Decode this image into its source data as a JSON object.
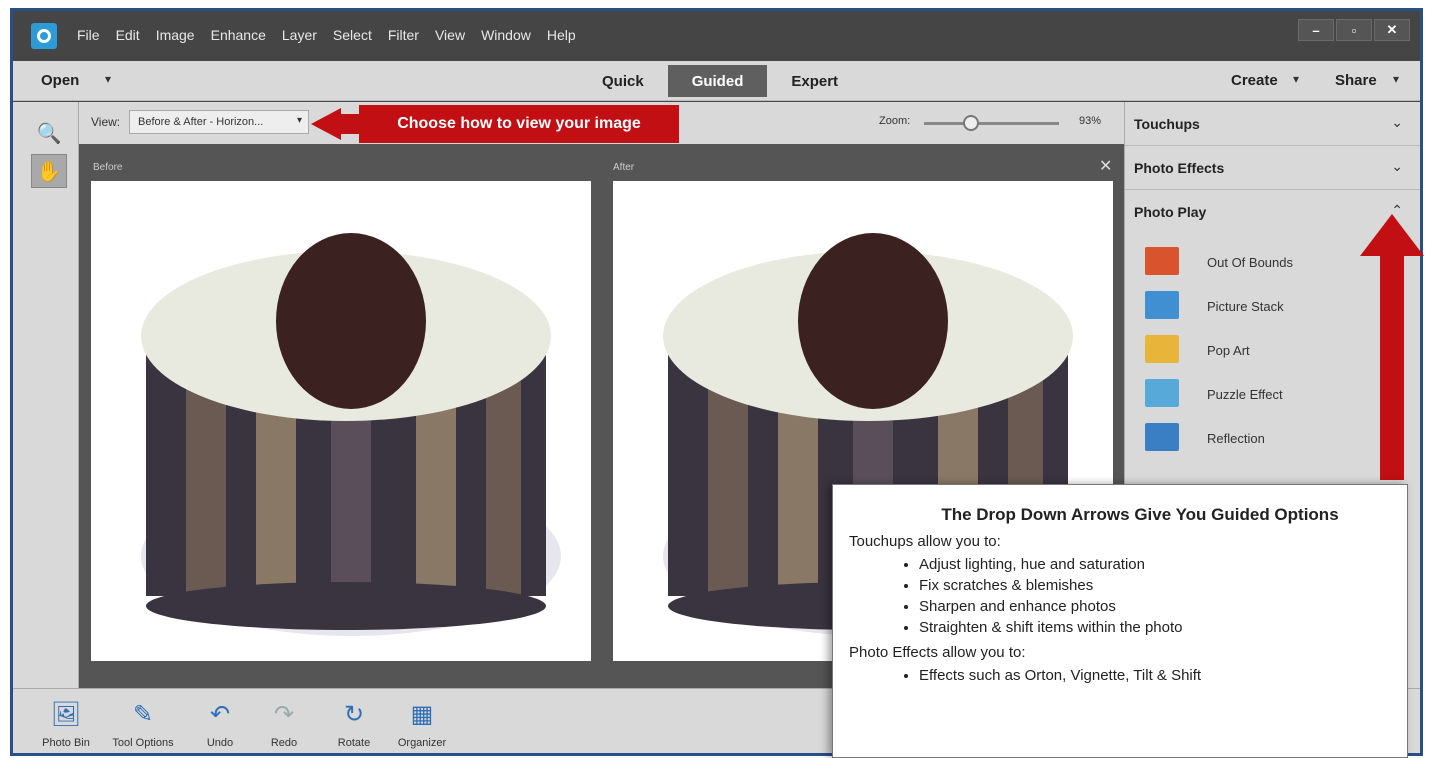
{
  "menubar": {
    "items": [
      "File",
      "Edit",
      "Image",
      "Enhance",
      "Layer",
      "Select",
      "Filter",
      "View",
      "Window",
      "Help"
    ],
    "window_controls": [
      "–",
      "▫",
      "✕"
    ]
  },
  "modebar": {
    "open_label": "Open",
    "caret": "▾",
    "tabs": [
      "Quick",
      "Guided",
      "Expert"
    ],
    "create_label": "Create",
    "share_label": "Share"
  },
  "tools": {
    "zoom_glyph": "🔍",
    "hand_glyph": "✋"
  },
  "options": {
    "view_label": "View:",
    "view_value": "Before & After - Horizon...",
    "callout_text": "Choose how to view your image",
    "zoom_label": "Zoom:",
    "zoom_value": "93%",
    "zoom_level_fraction": 0.35
  },
  "canvas": {
    "before_label": "Before",
    "after_label": "After",
    "close_glyph": "✕"
  },
  "rightpanel": {
    "sections": [
      {
        "title": "Touchups",
        "chevron": "⌄"
      },
      {
        "title": "Photo Effects",
        "chevron": "⌄"
      },
      {
        "title": "Photo Play",
        "chevron": "⌃"
      }
    ],
    "play_items": [
      {
        "label": "Out Of Bounds",
        "icon": "out-of-bounds-icon",
        "color": "#d9532c"
      },
      {
        "label": "Picture Stack",
        "icon": "picture-stack-icon",
        "color": "#3f8fd2"
      },
      {
        "label": "Pop Art",
        "icon": "pop-art-icon",
        "color": "#e9b43a"
      },
      {
        "label": "Puzzle Effect",
        "icon": "puzzle-effect-icon",
        "color": "#56a9d8"
      },
      {
        "label": "Reflection",
        "icon": "reflection-icon",
        "color": "#3a7ec4"
      }
    ]
  },
  "bottombar": {
    "items": [
      {
        "label": "Photo Bin",
        "glyph": "🖼"
      },
      {
        "label": "Tool Options",
        "glyph": "✎"
      },
      {
        "label": "Undo",
        "glyph": "↶"
      },
      {
        "label": "Redo",
        "glyph": "↷"
      },
      {
        "label": "Rotate",
        "glyph": "↻"
      },
      {
        "label": "Organizer",
        "glyph": "▦"
      }
    ]
  },
  "note": {
    "title": "The Drop Down Arrows Give You Guided Options",
    "touchups_intro": "Touchups allow you to:",
    "touchups_list": [
      "Adjust lighting, hue and saturation",
      "Fix scratches & blemishes",
      "Sharpen and enhance photos",
      "Straighten & shift items within the photo"
    ],
    "effects_intro": "Photo Effects allow you to:",
    "effects_list": [
      "Effects such as Orton, Vignette, Tilt & Shift"
    ]
  },
  "colors": {
    "accent_red": "#c10f13",
    "frame_blue": "#2a4e86",
    "panel_gray": "#d9d9d9",
    "active_tab": "#5f5f5f"
  }
}
